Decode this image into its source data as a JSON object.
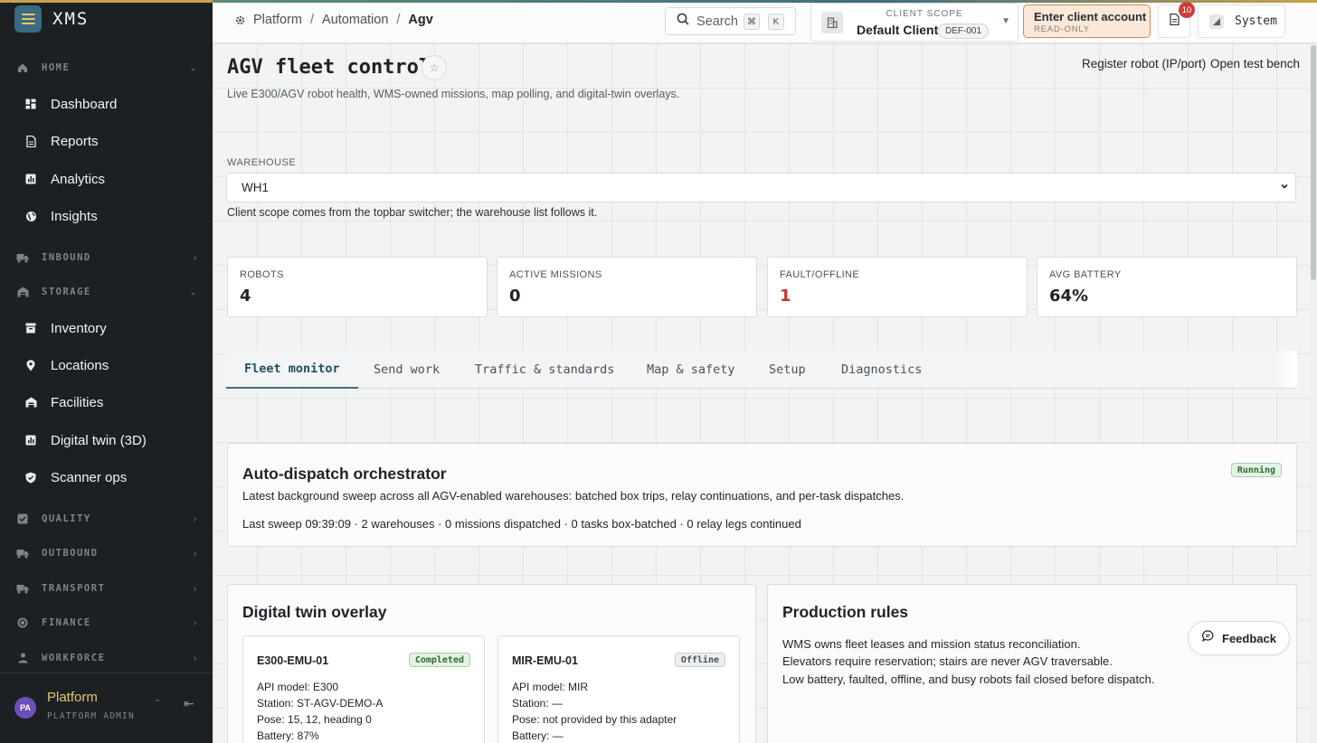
{
  "app": {
    "name": "XMS"
  },
  "sidebar": {
    "sections": {
      "home": "HOME",
      "inbound": "INBOUND",
      "storage": "STORAGE",
      "quality": "QUALITY",
      "outbound": "OUTBOUND",
      "transport": "TRANSPORT",
      "finance": "FINANCE",
      "workforce": "WORKFORCE"
    },
    "items": {
      "dashboard": "Dashboard",
      "reports": "Reports",
      "analytics": "Analytics",
      "insights": "Insights",
      "inventory": "Inventory",
      "locations": "Locations",
      "facilities": "Facilities",
      "digital_twin": "Digital twin (3D)",
      "scanner_ops": "Scanner ops"
    },
    "user": {
      "initials": "PA",
      "name": "Platform",
      "role": "PLATFORM ADMIN"
    }
  },
  "topbar": {
    "breadcrumb": [
      "Platform",
      "Automation",
      "Agv"
    ],
    "separator": "/",
    "search_label": "Search",
    "search_keys": [
      "⌘",
      "K"
    ],
    "client_scope": {
      "kicker": "CLIENT SCOPE",
      "value": "Default Client",
      "code": "DEF-001"
    },
    "enter_account": {
      "title": "Enter client account",
      "subtitle": "READ-ONLY"
    },
    "notification_count": "10",
    "system_label": "System"
  },
  "page": {
    "title": "AGV fleet control",
    "subtitle": "Live E300/AGV robot health, WMS-owned missions, map polling, and digital-twin overlays.",
    "actions": {
      "register": "Register robot (IP/port)",
      "test_bench": "Open test bench"
    }
  },
  "warehouse": {
    "label": "WAREHOUSE",
    "selected": "WH1",
    "help": "Client scope comes from the topbar switcher; the warehouse list follows it."
  },
  "stats": {
    "robots": {
      "label": "ROBOTS",
      "value": "4"
    },
    "active_missions": {
      "label": "ACTIVE MISSIONS",
      "value": "0"
    },
    "fault_offline": {
      "label": "FAULT/OFFLINE",
      "value": "1"
    },
    "avg_battery": {
      "label": "AVG BATTERY",
      "value": "64%"
    }
  },
  "tabs": [
    "Fleet monitor",
    "Send work",
    "Traffic & standards",
    "Map & safety",
    "Setup",
    "Diagnostics"
  ],
  "orchestrator": {
    "title": "Auto-dispatch orchestrator",
    "status": "Running",
    "description": "Latest background sweep across all AGV-enabled warehouses: batched box trips, relay continuations, and per-task dispatches.",
    "summary": "Last sweep 09:39:09 · 2 warehouses · 0 missions dispatched · 0 tasks box-batched · 0 relay legs continued"
  },
  "digital_twin": {
    "title": "Digital twin overlay",
    "robots": [
      {
        "name": "E300-EMU-01",
        "status": "Completed",
        "api_model": "API model: E300",
        "station": "Station: ST-AGV-DEMO-A",
        "pose": "Pose: 15, 12, heading 0",
        "battery": "Battery: 87%"
      },
      {
        "name": "MIR-EMU-01",
        "status": "Offline",
        "api_model": "API model: MIR",
        "station": "Station: —",
        "pose": "Pose: not provided by this adapter",
        "battery": "Battery: —"
      }
    ]
  },
  "production_rules": {
    "title": "Production rules",
    "rules": [
      "WMS owns fleet leases and mission status reconciliation.",
      "Elevators require reservation; stairs are never AGV traversable.",
      "Low battery, faulted, offline, and busy robots fail closed before dispatch."
    ]
  },
  "feedback_label": "Feedback",
  "colors": {
    "sidebar_bg": "#1d2023",
    "accent": "#3f6f83",
    "brand_yellow": "#e8c56a",
    "fault": "#c0392b",
    "enter_bg": "#fbe8d8"
  }
}
